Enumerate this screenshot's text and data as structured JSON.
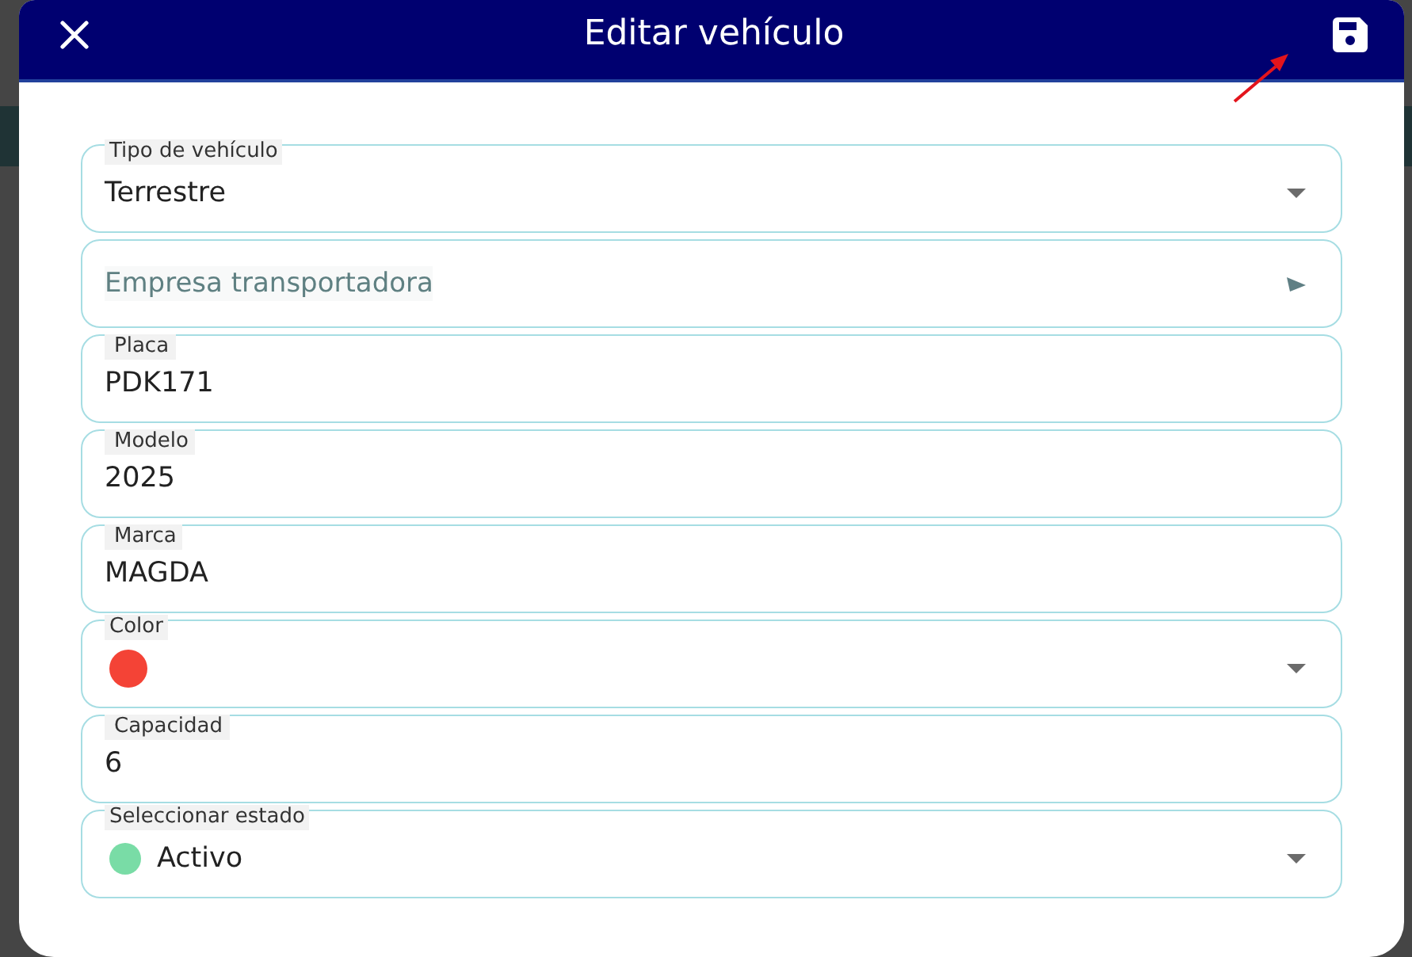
{
  "dialog": {
    "title": "Editar vehículo"
  },
  "fields": [
    {
      "kind": "select",
      "label": "Tipo de vehículo",
      "value": "Terrestre"
    },
    {
      "kind": "autocomplete",
      "placeholder": "Empresa transportadora"
    },
    {
      "kind": "text",
      "label": "Placa",
      "value": "PDK171"
    },
    {
      "kind": "text",
      "label": "Modelo",
      "value": "2025"
    },
    {
      "kind": "text",
      "label": "Marca",
      "value": "MAGDA"
    },
    {
      "kind": "color",
      "label": "Color",
      "color": "#f44336"
    },
    {
      "kind": "text",
      "label": "Capacidad",
      "value": "6"
    },
    {
      "kind": "status",
      "label": "Seleccionar estado",
      "value": "Activo",
      "color": "#79dca6"
    }
  ]
}
